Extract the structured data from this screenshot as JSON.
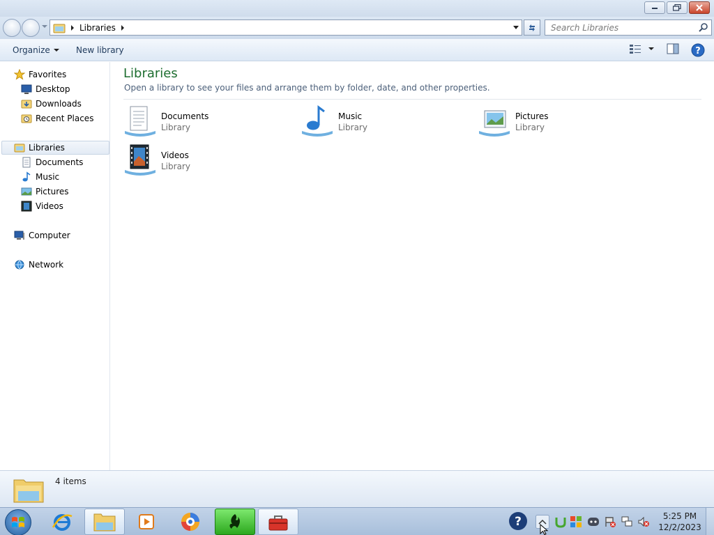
{
  "address": {
    "crumb": "Libraries"
  },
  "search": {
    "placeholder": "Search Libraries"
  },
  "toolbar": {
    "organize": "Organize",
    "new_library": "New library"
  },
  "sidebar": {
    "favorites": "Favorites",
    "desktop": "Desktop",
    "downloads": "Downloads",
    "recent_places": "Recent Places",
    "libraries": "Libraries",
    "documents": "Documents",
    "music": "Music",
    "pictures": "Pictures",
    "videos": "Videos",
    "computer": "Computer",
    "network": "Network"
  },
  "content": {
    "title": "Libraries",
    "subtitle": "Open a library to see your files and arrange them by folder, date, and other properties.",
    "items": [
      {
        "name": "Documents",
        "type": "Library",
        "icon": "documents-library-icon"
      },
      {
        "name": "Music",
        "type": "Library",
        "icon": "music-library-icon"
      },
      {
        "name": "Pictures",
        "type": "Library",
        "icon": "pictures-library-icon"
      },
      {
        "name": "Videos",
        "type": "Library",
        "icon": "videos-library-icon"
      }
    ]
  },
  "details": {
    "count": "4 items"
  },
  "taskbar": {
    "time": "5:25 PM",
    "date": "12/2/2023"
  },
  "colors": {
    "title_green": "#1e6e30",
    "taskbar": "#b0c6e0",
    "razer_green": "#3fc22f"
  }
}
